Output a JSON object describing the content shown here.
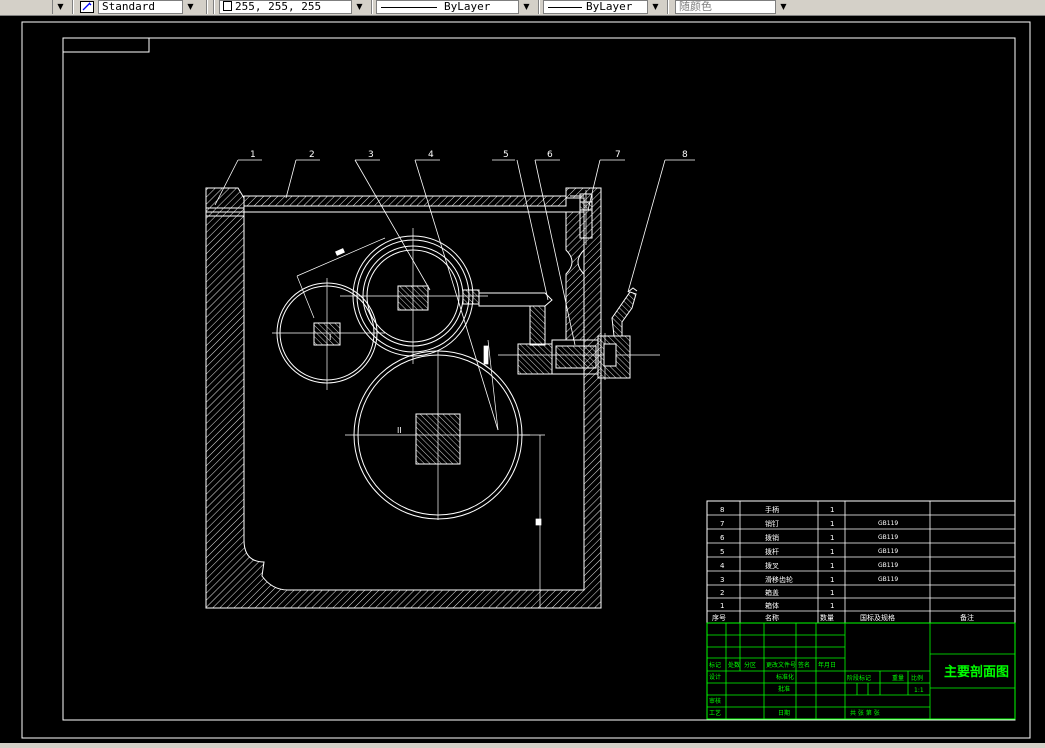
{
  "toolbar": {
    "text_style": "Standard",
    "color_value": "255, 255, 255",
    "linetype": "ByLayer",
    "lineweight": "ByLayer",
    "plot_style": "随颜色"
  },
  "drawing": {
    "callouts": [
      "1",
      "2",
      "3",
      "4",
      "5",
      "6",
      "7",
      "8"
    ],
    "roman_labels": [
      "I",
      "II"
    ]
  },
  "parts_list": {
    "rows": [
      {
        "no": "8",
        "name": "手柄",
        "qty": "1",
        "spec": ""
      },
      {
        "no": "7",
        "name": "销钉",
        "qty": "1",
        "spec": "GB119"
      },
      {
        "no": "6",
        "name": "拨销",
        "qty": "1",
        "spec": "GB119"
      },
      {
        "no": "5",
        "name": "拨杆",
        "qty": "1",
        "spec": "GB119"
      },
      {
        "no": "4",
        "name": "拨叉",
        "qty": "1",
        "spec": "GB119"
      },
      {
        "no": "3",
        "name": "滑移齿轮",
        "qty": "1",
        "spec": "GB119"
      },
      {
        "no": "2",
        "name": "箱盖",
        "qty": "1",
        "spec": ""
      },
      {
        "no": "1",
        "name": "箱体",
        "qty": "1",
        "spec": ""
      }
    ],
    "header": {
      "no": "序号",
      "name": "名称",
      "qty": "数量",
      "spec": "国标及规格",
      "note": "备注"
    }
  },
  "title_block": {
    "title": "主要剖面图",
    "row_labels": [
      "标记",
      "处数",
      "分区",
      "更改文件号",
      "签名",
      "年月日"
    ],
    "left_labels": [
      "设计",
      "审核",
      "工艺"
    ],
    "mid_labels": [
      "标准化",
      "批准",
      "日期"
    ],
    "right_labels": [
      "阶段标记",
      "重量",
      "比例"
    ],
    "scale": "1:1",
    "sheet_text": "共 张 第 张"
  }
}
